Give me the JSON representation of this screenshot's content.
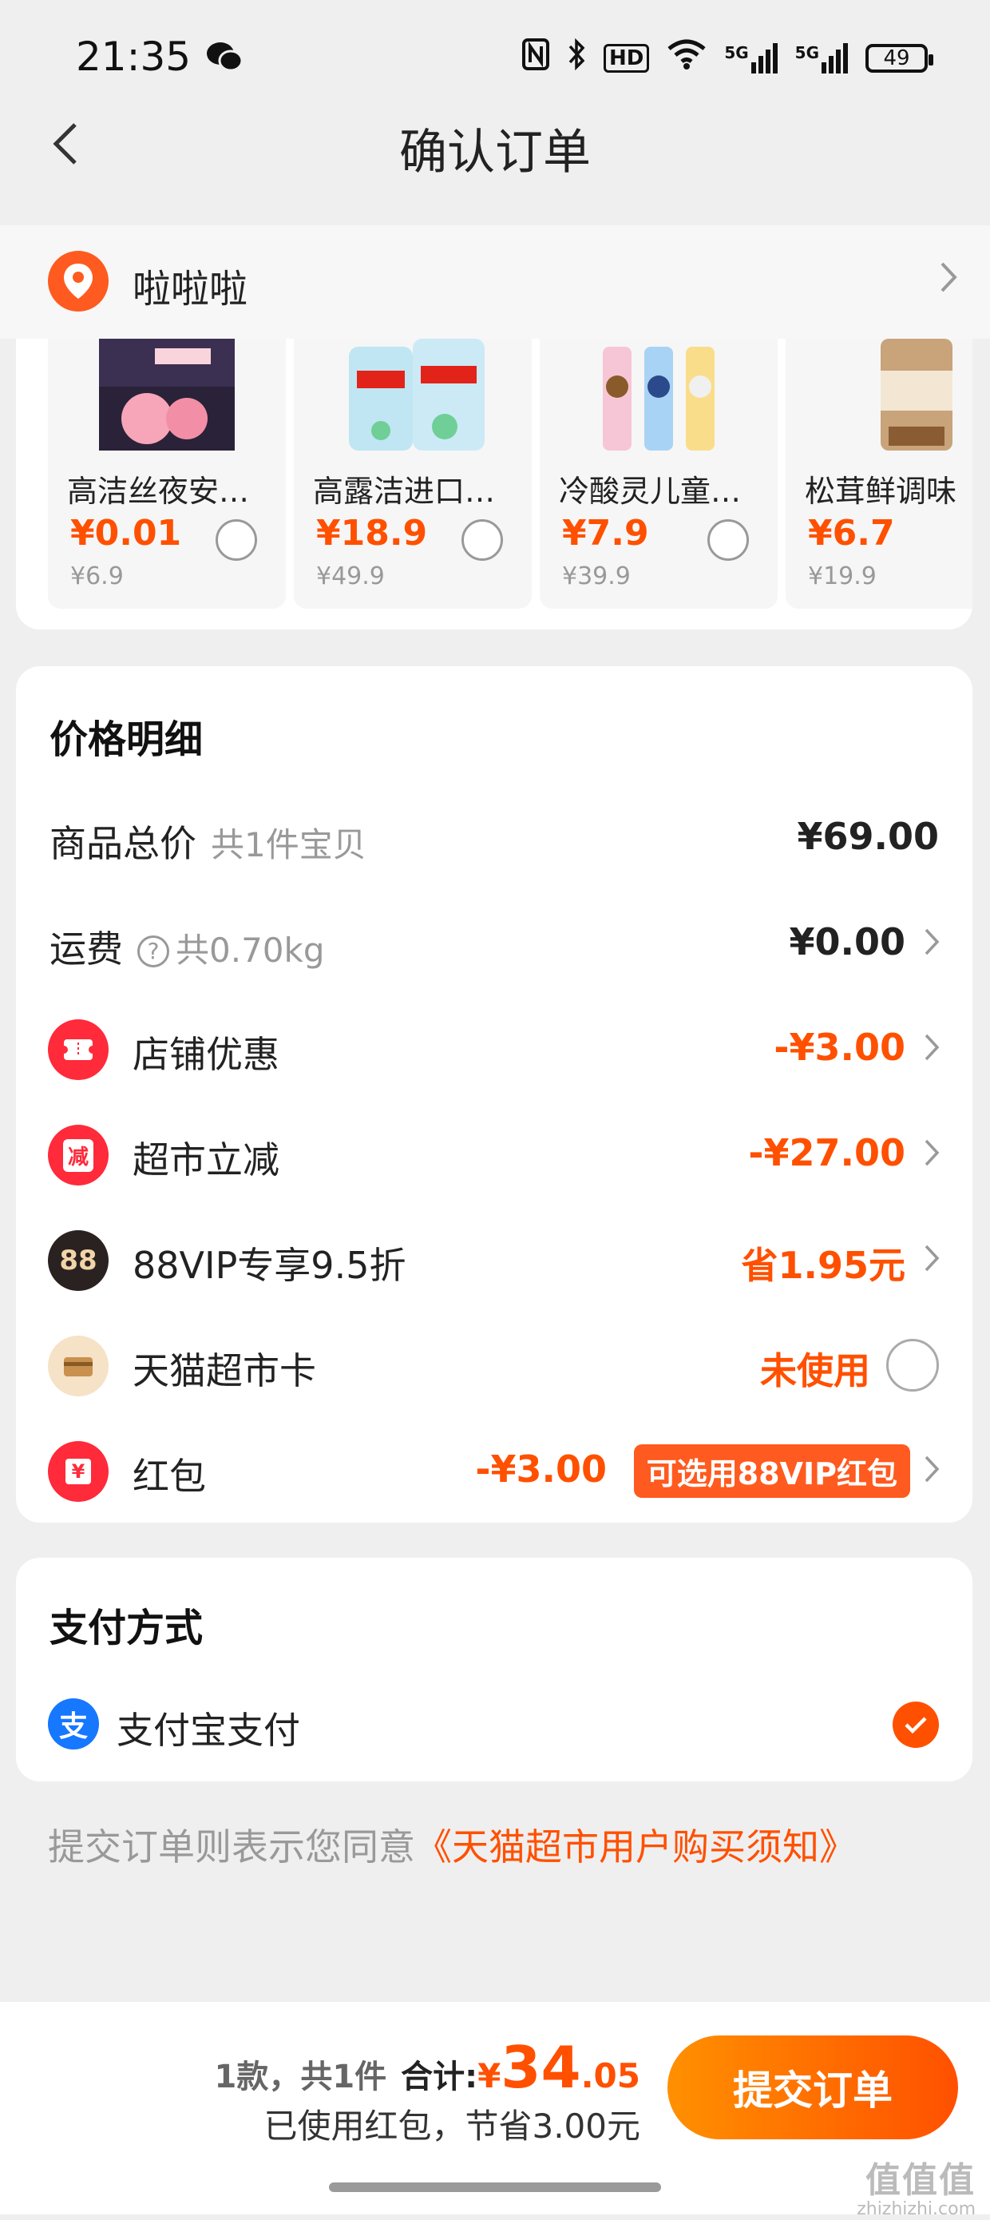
{
  "status_bar": {
    "time": "21:35",
    "network_labels": [
      "5G",
      "5G"
    ],
    "hd_label": "HD",
    "battery": "49"
  },
  "header": {
    "title": "确认订单"
  },
  "address": {
    "name": "啦啦啦"
  },
  "products": [
    {
      "name": "高洁丝夜安裤...",
      "price": "¥0.01",
      "original": "¥6.9"
    },
    {
      "name": "高露洁进口抑...",
      "price": "¥18.9",
      "original": "¥49.9"
    },
    {
      "name": "冷酸灵儿童牙...",
      "price": "¥7.9",
      "original": "¥39.9"
    },
    {
      "name": "松茸鲜调味",
      "price": "¥6.7",
      "original": "¥19.9"
    }
  ],
  "price_detail": {
    "title": "价格明细",
    "goods_total": {
      "label": "商品总价",
      "sub": "共1件宝贝",
      "value": "¥69.00"
    },
    "shipping": {
      "label": "运费",
      "sub": "共0.70kg",
      "value": "¥0.00"
    },
    "store_discount": {
      "label": "店铺优惠",
      "value": "-¥3.00"
    },
    "market_cut": {
      "label": "超市立减",
      "value": "-¥27.00",
      "icon_text": "减"
    },
    "vip": {
      "label": "88VIP专享9.5折",
      "value": "省1.95元",
      "icon_text": "88"
    },
    "market_card": {
      "label": "天猫超市卡",
      "value": "未使用"
    },
    "red_packet": {
      "label": "红包",
      "value": "-¥3.00",
      "badge": "可选用88VIP红包",
      "icon_text": "¥"
    }
  },
  "payment": {
    "title": "支付方式",
    "method": "支付宝支付",
    "icon_text": "支"
  },
  "agreement": {
    "prefix": "提交订单则表示您同意",
    "link": "《天猫超市用户购买须知》"
  },
  "footer": {
    "count": "1款，共1件",
    "total_label": "合计:",
    "currency": "¥",
    "total_int": "34",
    "total_dec": ".05",
    "saving": "已使用红包，节省3.00元",
    "submit": "提交订单"
  },
  "watermark": {
    "big": "值值值",
    "small": "zhizhizhi.com"
  },
  "colors": {
    "accent": "#ff5000",
    "alipay": "#1677ff"
  }
}
